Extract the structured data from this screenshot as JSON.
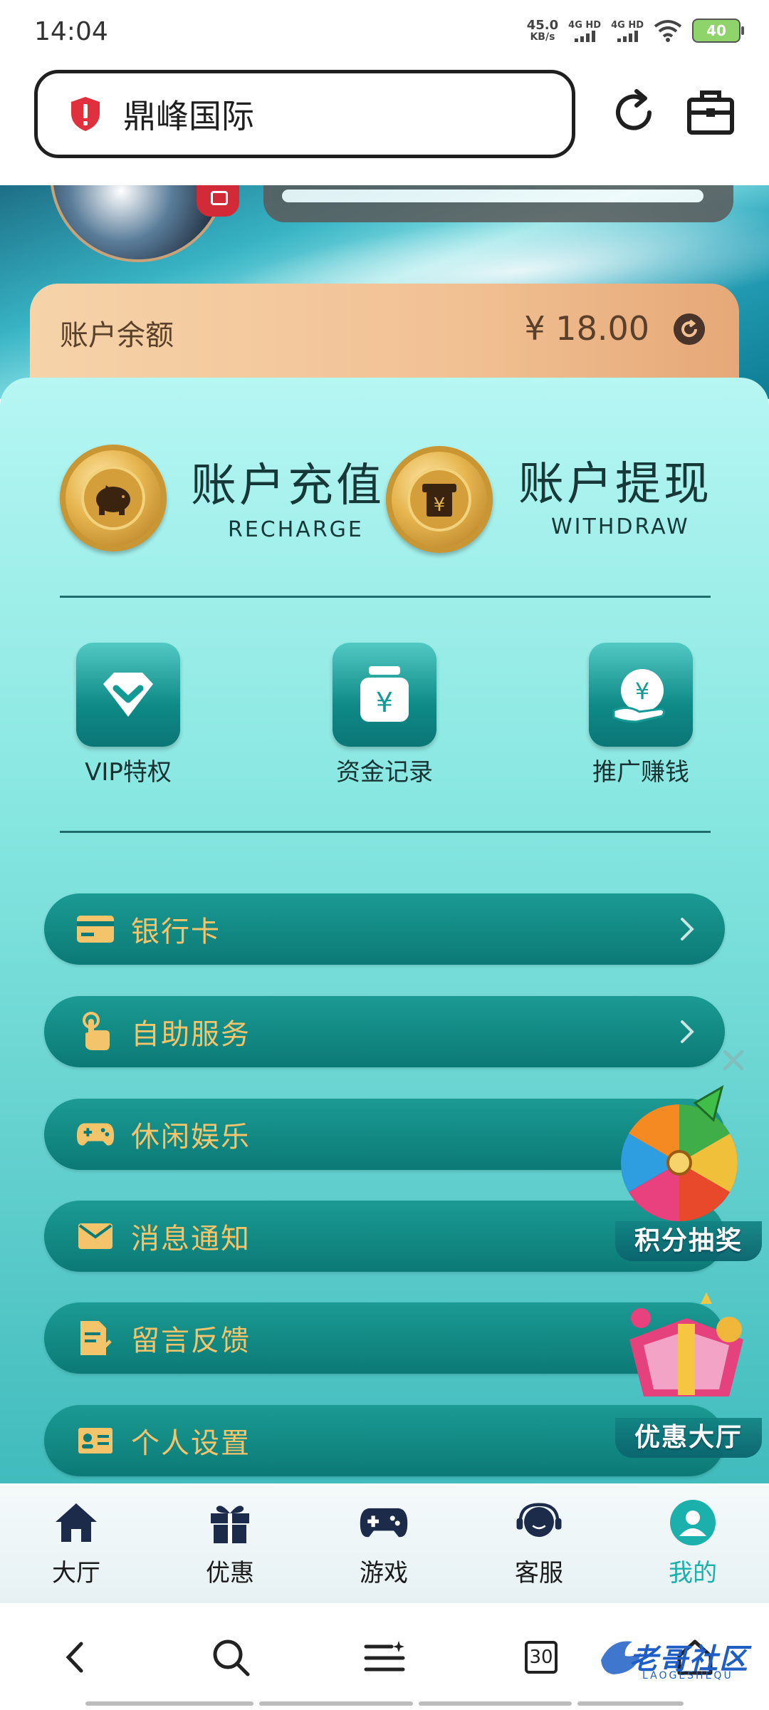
{
  "status_bar": {
    "time": "14:04",
    "net_speed_value": "45.0",
    "net_speed_unit": "KB/s",
    "sim1": "4G HD",
    "sim2": "4G HD",
    "battery": "40"
  },
  "browser": {
    "site_title": "鼎峰国际"
  },
  "balance": {
    "label": "账户余额",
    "amount": "¥ 18.00"
  },
  "actions": {
    "recharge": {
      "title": "账户充值",
      "subtitle": "RECHARGE"
    },
    "withdraw": {
      "title": "账户提现",
      "subtitle": "WITHDRAW"
    }
  },
  "quick_links": [
    {
      "label": "VIP特权",
      "icon": "diamond-icon"
    },
    {
      "label": "资金记录",
      "icon": "money-jar-icon"
    },
    {
      "label": "推广赚钱",
      "icon": "yuan-hand-icon"
    }
  ],
  "menu": [
    {
      "label": "银行卡",
      "icon": "bank-card-icon"
    },
    {
      "label": "自助服务",
      "icon": "touch-hand-icon"
    },
    {
      "label": "休闲娱乐",
      "icon": "gamepad-icon"
    },
    {
      "label": "消息通知",
      "icon": "envelope-icon"
    },
    {
      "label": "留言反馈",
      "icon": "feedback-doc-icon"
    },
    {
      "label": "个人设置",
      "icon": "id-card-icon"
    }
  ],
  "widgets": {
    "wheel_label": "积分抽奖",
    "promo_label": "优惠大厅"
  },
  "tabs": [
    {
      "label": "大厅",
      "icon": "home-icon"
    },
    {
      "label": "优惠",
      "icon": "gift-icon"
    },
    {
      "label": "游戏",
      "icon": "gamepad-icon"
    },
    {
      "label": "客服",
      "icon": "headset-icon"
    },
    {
      "label": "我的",
      "icon": "user-icon",
      "active": true
    }
  ],
  "browser_nav": {
    "tab_count": "30"
  },
  "watermark": {
    "text": "老哥社区",
    "sub": "LAOGESHEQU"
  },
  "colors": {
    "accent_teal": "#1bb0ac",
    "menu_text_gold": "#f4c46b",
    "balance_bar": "#f1c194"
  }
}
